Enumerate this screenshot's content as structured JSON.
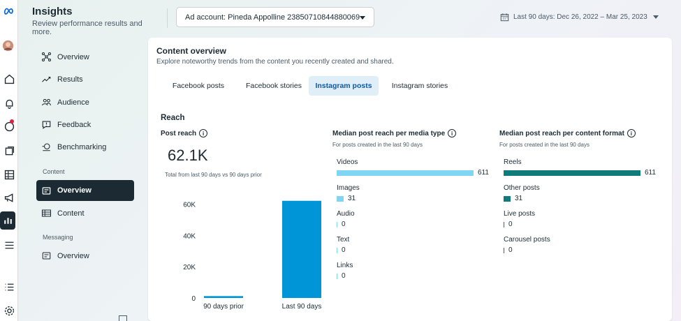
{
  "header": {
    "title": "Insights",
    "subtitle": "Review performance results and more.",
    "ad_account": "Ad account: Pineda Appolline 23850710844880069",
    "date_range": "Last 90 days: Dec 26, 2022 – Mar 25, 2023"
  },
  "sidebar": {
    "items": [
      {
        "label": "Overview",
        "icon": "sitemap-icon"
      },
      {
        "label": "Results",
        "icon": "trend-icon"
      },
      {
        "label": "Audience",
        "icon": "people-icon"
      },
      {
        "label": "Feedback",
        "icon": "speech-bubble-icon"
      },
      {
        "label": "Benchmarking",
        "icon": "compare-icon"
      }
    ],
    "content_header": "Content",
    "content_items": [
      {
        "label": "Overview",
        "active": true
      },
      {
        "label": "Content"
      }
    ],
    "messaging_header": "Messaging",
    "messaging_items": [
      {
        "label": "Overview"
      }
    ]
  },
  "content": {
    "title": "Content overview",
    "subtitle": "Explore noteworthy trends from the content you recently created and shared.",
    "tabs": [
      "Facebook posts",
      "Facebook stories",
      "Instagram posts",
      "Instagram stories"
    ],
    "active_tab": "Instagram posts",
    "section": "Reach",
    "post_reach": {
      "label": "Post reach",
      "value": "62.1K",
      "caption": "Total from last 90 days vs 90 days prior"
    },
    "media_type": {
      "title": "Median post reach per media type",
      "caption": "For posts created in the last 90 days",
      "color": "#7fd6f2"
    },
    "content_format": {
      "title": "Median post reach per content format",
      "caption": "For posts created in the last 90 days",
      "color": "#0f7b7b"
    }
  },
  "chart_data": [
    {
      "type": "bar",
      "categories": [
        "90 days prior",
        "Last 90 days"
      ],
      "values": [
        1200,
        62100
      ],
      "ylim": [
        0,
        66000
      ],
      "yticks": [
        "0",
        "20K",
        "40K",
        "60K"
      ],
      "yvals": [
        0,
        20000,
        40000,
        60000
      ],
      "color": "#0095d6"
    },
    {
      "type": "bar",
      "orientation": "horizontal",
      "categories": [
        "Videos",
        "Images",
        "Audio",
        "Text",
        "Links"
      ],
      "values": [
        611,
        31,
        0,
        0,
        0
      ],
      "labels": [
        "611",
        "31",
        "0",
        "0",
        "0"
      ]
    },
    {
      "type": "bar",
      "orientation": "horizontal",
      "categories": [
        "Reels",
        "Other posts",
        "Live posts",
        "Carousel posts"
      ],
      "values": [
        611,
        31,
        0,
        0
      ],
      "labels": [
        "611",
        "31",
        "0",
        "0"
      ]
    }
  ]
}
